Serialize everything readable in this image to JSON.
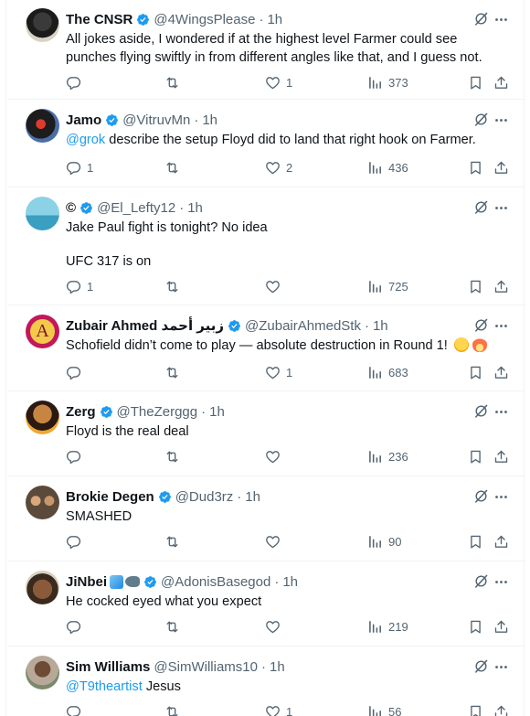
{
  "posts": [
    {
      "name": "The CNSR",
      "handle": "@4WingsPlease",
      "time": "1h",
      "body": [
        {
          "text": "All jokes aside, I wondered if at the highest level Farmer could see punches flying swiftly in from different angles like that, and I guess not."
        }
      ],
      "replies": "",
      "retweets": "",
      "likes": "1",
      "views": "373"
    },
    {
      "name": "Jamo",
      "handle": "@VitruvMn",
      "time": "1h",
      "mention": "@grok",
      "body_text": " describe the setup Floyd did to land that right hook on Farmer.",
      "replies": "1",
      "retweets": "",
      "likes": "2",
      "views": "436"
    },
    {
      "name": "©",
      "handle": "@El_Lefty12",
      "time": "1h",
      "line1": "Jake Paul fight is tonight? No idea",
      "line2": "UFC 317 is on",
      "replies": "1",
      "retweets": "",
      "likes": "",
      "views": "725"
    },
    {
      "name": "Zubair Ahmed زبیر أحمد",
      "handle": "@ZubairAhmedStk",
      "time": "1h",
      "body_text": "Schofield didn’t come to play — absolute destruction in Round 1!",
      "replies": "",
      "retweets": "",
      "likes": "1",
      "views": "683",
      "avatar_letter": "A"
    },
    {
      "name": "Zerg",
      "handle": "@TheZerggg",
      "time": "1h",
      "body_text": "Floyd is the real deal",
      "replies": "",
      "retweets": "",
      "likes": "",
      "views": "236"
    },
    {
      "name": "Brokie Degen",
      "handle": "@Dud3rz",
      "time": "1h",
      "body_text": "SMASHED",
      "replies": "",
      "retweets": "",
      "likes": "",
      "views": "90"
    },
    {
      "name": "JiNbei",
      "handle": "@AdonisBasegod",
      "time": "1h",
      "body_text": "He cocked eyed what you expect",
      "replies": "",
      "retweets": "",
      "likes": "",
      "views": "219"
    },
    {
      "name": "Sim Williams",
      "handle": "@SimWilliams10",
      "time": "1h",
      "mention": "@T9theartist",
      "body_text": " Jesus",
      "replies": "",
      "retweets": "",
      "likes": "1",
      "views": "56"
    }
  ],
  "separator": "·",
  "icons": {
    "verified": "verified-badge-icon",
    "grok": "grok-icon",
    "more": "more-icon",
    "reply": "reply-icon",
    "retweet": "retweet-icon",
    "like": "like-icon",
    "views": "views-icon",
    "bookmark": "bookmark-icon",
    "share": "share-icon"
  },
  "colors": {
    "text": "#0f1419",
    "secondary": "#536471",
    "link": "#1d9bf0",
    "verified": "#1d9bf0",
    "border": "#eff3f4"
  }
}
